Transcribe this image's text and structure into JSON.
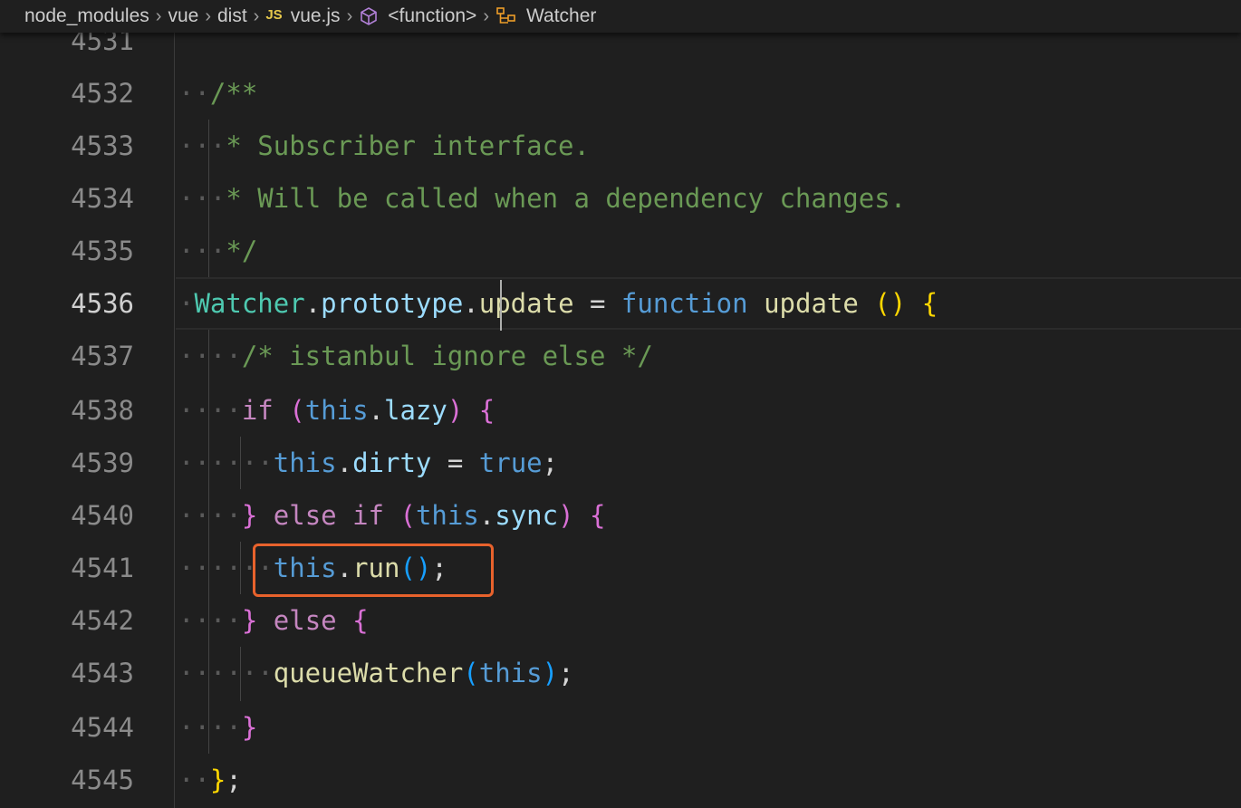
{
  "breadcrumb": {
    "items": [
      "node_modules",
      "vue",
      "dist",
      "vue.js",
      "<function>",
      "Watcher"
    ],
    "js_badge": "JS",
    "icons": [
      "chevron-right-icon",
      "js-file-icon",
      "cube-method-icon",
      "class-symbol-icon"
    ]
  },
  "editor": {
    "current_line": 4536,
    "highlighted_line": 4541,
    "lines": [
      {
        "number": "4531"
      },
      {
        "number": "4532",
        "text": "/**"
      },
      {
        "number": "4533",
        "text": "* Subscriber interface."
      },
      {
        "number": "4534",
        "text": "* Will be called when a dependency changes."
      },
      {
        "number": "4535",
        "text": "*/"
      },
      {
        "number": "4536",
        "text": "Watcher.prototype.update = function update () {"
      },
      {
        "number": "4537",
        "text": "/* istanbul ignore else */"
      },
      {
        "number": "4538",
        "text": "if (this.lazy) {"
      },
      {
        "number": "4539",
        "text": "this.dirty = true;"
      },
      {
        "number": "4540",
        "text": "} else if (this.sync) {"
      },
      {
        "number": "4541",
        "text": "this.run();"
      },
      {
        "number": "4542",
        "text": "} else {"
      },
      {
        "number": "4543",
        "text": "queueWatcher(this);"
      },
      {
        "number": "4544",
        "text": "}"
      },
      {
        "number": "4545",
        "text": "};"
      }
    ]
  },
  "colors": {
    "background": "#1f1f1f",
    "comment": "#6a9955",
    "class": "#4ec9b0",
    "property": "#9cdcfe",
    "function": "#dcdcaa",
    "keyword": "#569cd6",
    "control": "#c586c0",
    "bracket_1": "#ffd700",
    "bracket_2": "#da70d6",
    "bracket_3": "#179fff",
    "highlight_box": "#e8622c"
  }
}
